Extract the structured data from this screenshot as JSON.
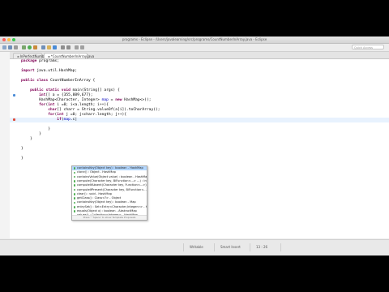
{
  "window": {
    "title": "programs - Eclipse - /Users/javalearning/src/programs/CountNumberInArray.java - Eclipse"
  },
  "toolbar": {
    "quick_access": "Quick Access"
  },
  "tabs": [
    {
      "label": "InPerfectNumber.java"
    },
    {
      "label": "*CountNumberInArray.java"
    }
  ],
  "code": {
    "lines": [
      "package programs;",
      "",
      "import java.util.HashMap;",
      "",
      "public class CountNumberInArray {",
      "",
      "    public static void main(String[] args) {",
      "        int[] a = {355,889,677};",
      "        HashMap<Character, Integer> map = new HashMap<>();",
      "        for(int i =0; i<a.length; i++){",
      "            char[] charr = String.valueOf(a[i]).toCharArray();",
      "            for(int j =0; j<charr.length; j++){",
      "                if(map.c|",
      "",
      "            }",
      "        }",
      "    }",
      "",
      "}",
      "",
      "}"
    ]
  },
  "autocomplete": {
    "items": [
      "containsKey(Object key) : boolean - HashMap",
      "clone() : Object - HashMap",
      "containsValue(Object value) : boolean - HashMap",
      "compute(Character key, BiFunction<...> ...) : Integer",
      "computeIfAbsent(Character key, Function<...>) : Integer",
      "computeIfPresent(Character key, BiFunction<...>)",
      "clear() : void - HashMap",
      "getClass() : Class<?> - Object",
      "containsKey(Object key) : boolean - Map",
      "entrySet() : Set<Entry<Character,Integer>> - HashMap",
      "equals(Object o) : boolean - AbstractMap",
      "values() : Collection<Integer> - HashMap"
    ],
    "status": "Press '^Space' to show Template Proposals"
  },
  "statusbar": {
    "writable": "Writable",
    "insert_mode": "Smart Insert",
    "position": "13 : 26"
  }
}
